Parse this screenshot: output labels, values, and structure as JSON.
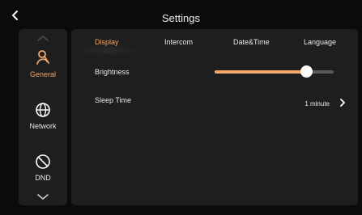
{
  "header": {
    "title": "Settings"
  },
  "sidebar": {
    "items": [
      {
        "label": "General",
        "icon": "wrench-person-icon",
        "active": true
      },
      {
        "label": "Network",
        "icon": "globe-icon",
        "active": false
      },
      {
        "label": "DND",
        "icon": "do-not-disturb-icon",
        "active": false
      }
    ]
  },
  "tabs": [
    {
      "label": "Display",
      "active": true
    },
    {
      "label": "Intercom",
      "active": false
    },
    {
      "label": "Date&Time",
      "active": false
    },
    {
      "label": "Language",
      "active": false
    }
  ],
  "display": {
    "brightness_label": "Brightness",
    "brightness_level": 0.77,
    "sleep_label": "Sleep Time",
    "sleep_value": "1 minute"
  },
  "colors": {
    "accent": "#f3a86b",
    "background": "#0b0b0b",
    "panel": "#1e1e1e",
    "track": "#5a5a5a"
  }
}
